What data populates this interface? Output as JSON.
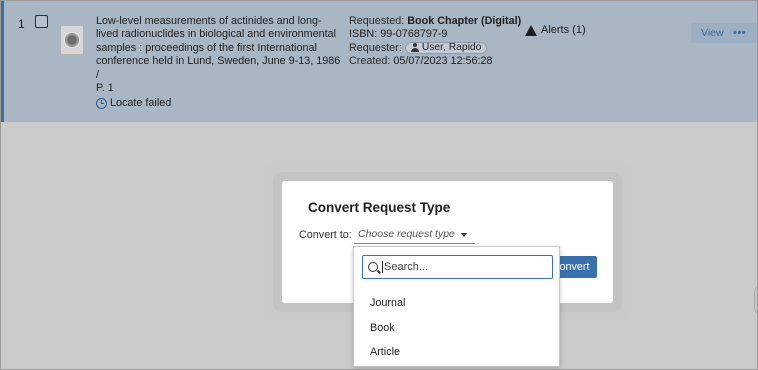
{
  "record": {
    "index": "1",
    "title": "Low-level measurements of actinides and long-lived radionuclides in biological and environmental samples : proceedings of the first International conference held in Lund, Sweden, June 9-13, 1986 / P. 1",
    "title_lines": [
      "Low-level measurements of actinides and long-",
      "lived radionuclides in biological and environmental",
      "samples : proceedings of the first International",
      "conference held in Lund, Sweden, June 9-13, 1986 /",
      "P. 1"
    ],
    "locate_status": "Locate failed",
    "requested_label": "Requested:",
    "requested_value": "Book Chapter (Digital)",
    "isbn": "ISBN: 99-0768797-9",
    "requester_label": "Requester:",
    "requester_value": "User, Rapido",
    "created_label": "Created:",
    "created_value": "05/07/2023 12:56:28",
    "alerts": "Alerts (1)",
    "view_label": "View",
    "more_label": "•••"
  },
  "modal": {
    "title": "Convert Request Type",
    "convert_to_label": "Convert to:",
    "select_placeholder": "Choose request type",
    "convert_button": "onvert"
  },
  "dropdown": {
    "search_placeholder": "Search...",
    "options": [
      "Journal",
      "Book",
      "Article"
    ]
  },
  "colors": {
    "row_background": "#a9b6c4",
    "accent_blue": "#3a71ad",
    "overlay_gray": "#cbcbcb"
  }
}
